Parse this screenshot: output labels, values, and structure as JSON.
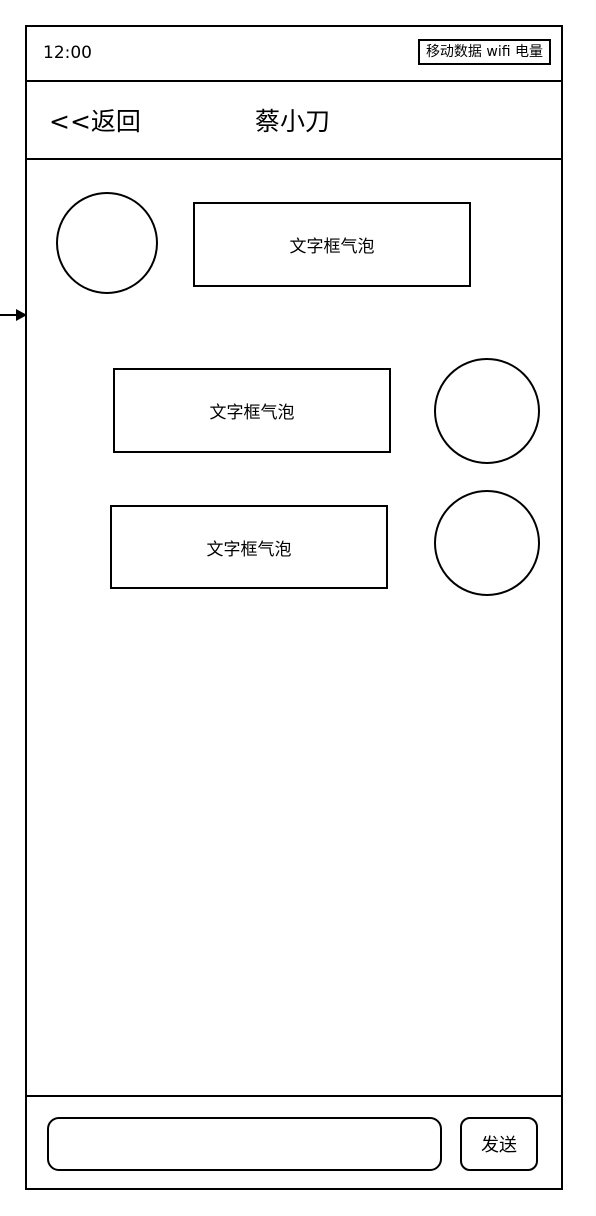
{
  "status_bar": {
    "time": "12:00",
    "indicators": "移动数据 wifi 电量"
  },
  "nav": {
    "back_label": "<<返回",
    "title": "蔡小刀"
  },
  "messages": [
    {
      "side": "left",
      "text": "文字框气泡"
    },
    {
      "side": "right",
      "text": "文字框气泡"
    },
    {
      "side": "right",
      "text": "文字框气泡"
    }
  ],
  "composer": {
    "input_value": "",
    "send_label": "发送"
  }
}
